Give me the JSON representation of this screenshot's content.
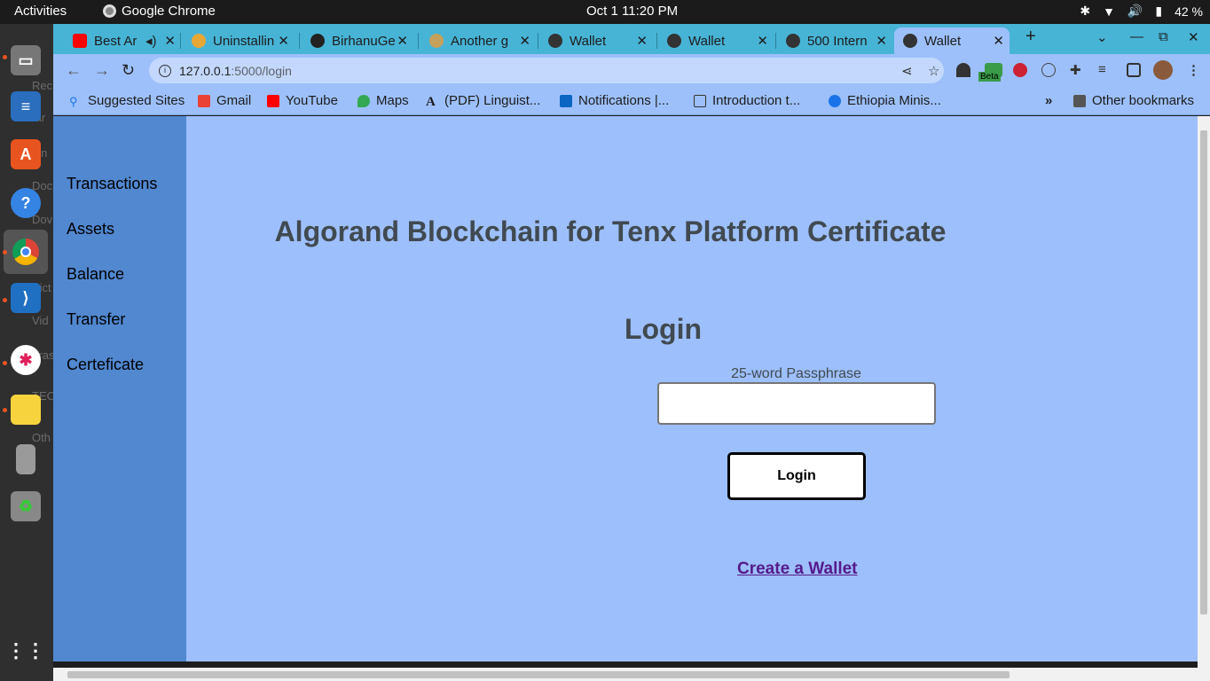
{
  "topbar": {
    "activities": "Activities",
    "app_name": "Google Chrome",
    "clock": "Oct 1  11:20 PM",
    "battery": "42 %"
  },
  "dock": {
    "ghost_labels": [
      "Rec",
      "tar",
      "lon",
      "Doc",
      "Dov",
      "Pict",
      "Vid",
      "Tras",
      "TEC",
      "Oth"
    ]
  },
  "browser": {
    "tabs": [
      {
        "title": "Best Ar",
        "active": false
      },
      {
        "title": "Uninstallin",
        "active": false
      },
      {
        "title": "BirhanuGe",
        "active": false
      },
      {
        "title": "Another g",
        "active": false
      },
      {
        "title": "Wallet",
        "active": false
      },
      {
        "title": "Wallet",
        "active": false
      },
      {
        "title": "500 Intern",
        "active": false
      },
      {
        "title": "Wallet",
        "active": true
      }
    ],
    "url_host": "127.0.0.1",
    "url_path": ":5000/login",
    "bookmarks": [
      "Suggested Sites",
      "Gmail",
      "YouTube",
      "Maps",
      "(PDF) Linguist...",
      "Notifications |...",
      "Introduction t...",
      "Ethiopia Minis..."
    ],
    "more_bookmarks": "»",
    "other_bookmarks": "Other bookmarks",
    "beta_badge": "Beta"
  },
  "sidebar": {
    "items": [
      "Transactions",
      "Assets",
      "Balance",
      "Transfer",
      "Certeficate"
    ]
  },
  "main": {
    "title": "Algorand Blockchain for Tenx Platform Certificate",
    "login_heading": "Login",
    "passphrase_label": "25-word Passphrase",
    "passphrase_value": "",
    "login_button": "Login",
    "create_wallet_link": "Create a Wallet"
  }
}
